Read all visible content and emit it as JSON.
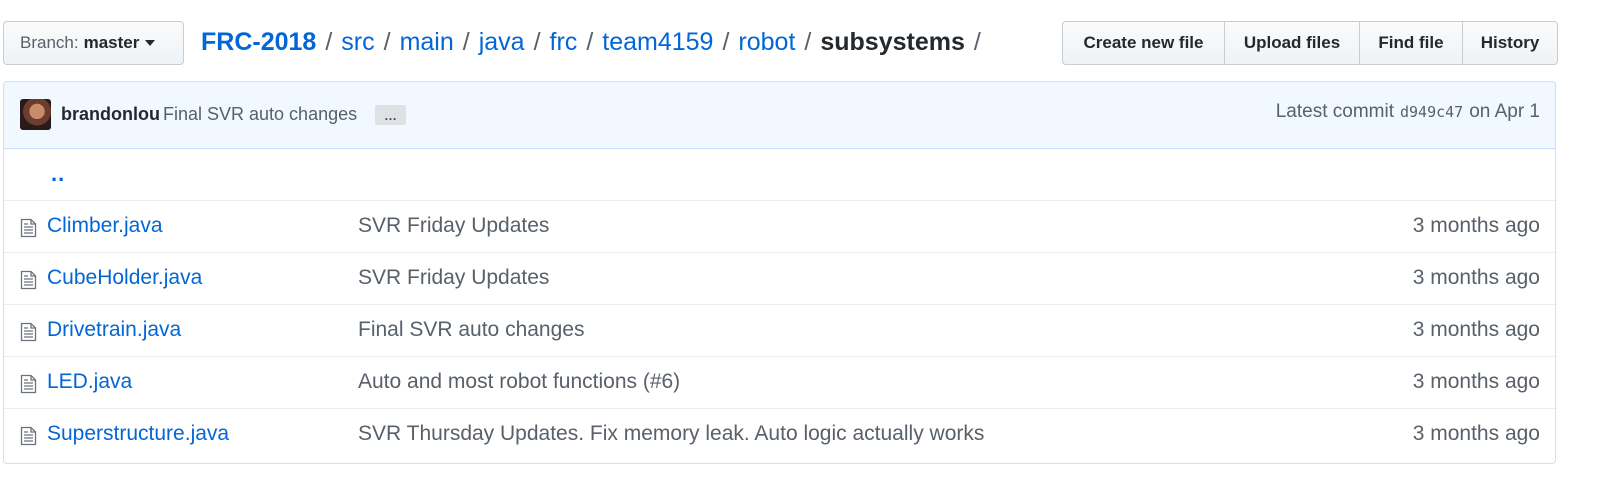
{
  "branch": {
    "label": "Branch:",
    "value": "master"
  },
  "breadcrumb": {
    "repo": "FRC-2018",
    "segments": [
      "src",
      "main",
      "java",
      "frc",
      "team4159",
      "robot"
    ],
    "current": "subsystems",
    "separator": "/"
  },
  "toolbar": {
    "create_label": "Create new file",
    "upload_label": "Upload files",
    "find_label": "Find file",
    "history_label": "History"
  },
  "commit": {
    "author": "brandonlou",
    "message": "Final SVR auto changes",
    "ellipsis": "…",
    "latest_label": "Latest commit",
    "sha": "d949c47",
    "date": "on Apr 1"
  },
  "parent_dir": "..",
  "files": [
    {
      "name": "Climber.java",
      "message": "SVR Friday Updates",
      "age": "3 months ago"
    },
    {
      "name": "CubeHolder.java",
      "message": "SVR Friday Updates",
      "age": "3 months ago"
    },
    {
      "name": "Drivetrain.java",
      "message": "Final SVR auto changes",
      "age": "3 months ago"
    },
    {
      "name": "LED.java",
      "message": "Auto and most robot functions (#6)",
      "age": "3 months ago"
    },
    {
      "name": "Superstructure.java",
      "message": "SVR Thursday Updates. Fix memory leak. Auto logic actually works",
      "age": "3 months ago"
    }
  ],
  "colors": {
    "link": "#0366d6",
    "muted": "#586069",
    "commit_bg": "#f1f8ff",
    "commit_border": "#c8e1ff"
  },
  "icons": {
    "file": "file-text-icon",
    "caret": "chevron-down-icon"
  }
}
